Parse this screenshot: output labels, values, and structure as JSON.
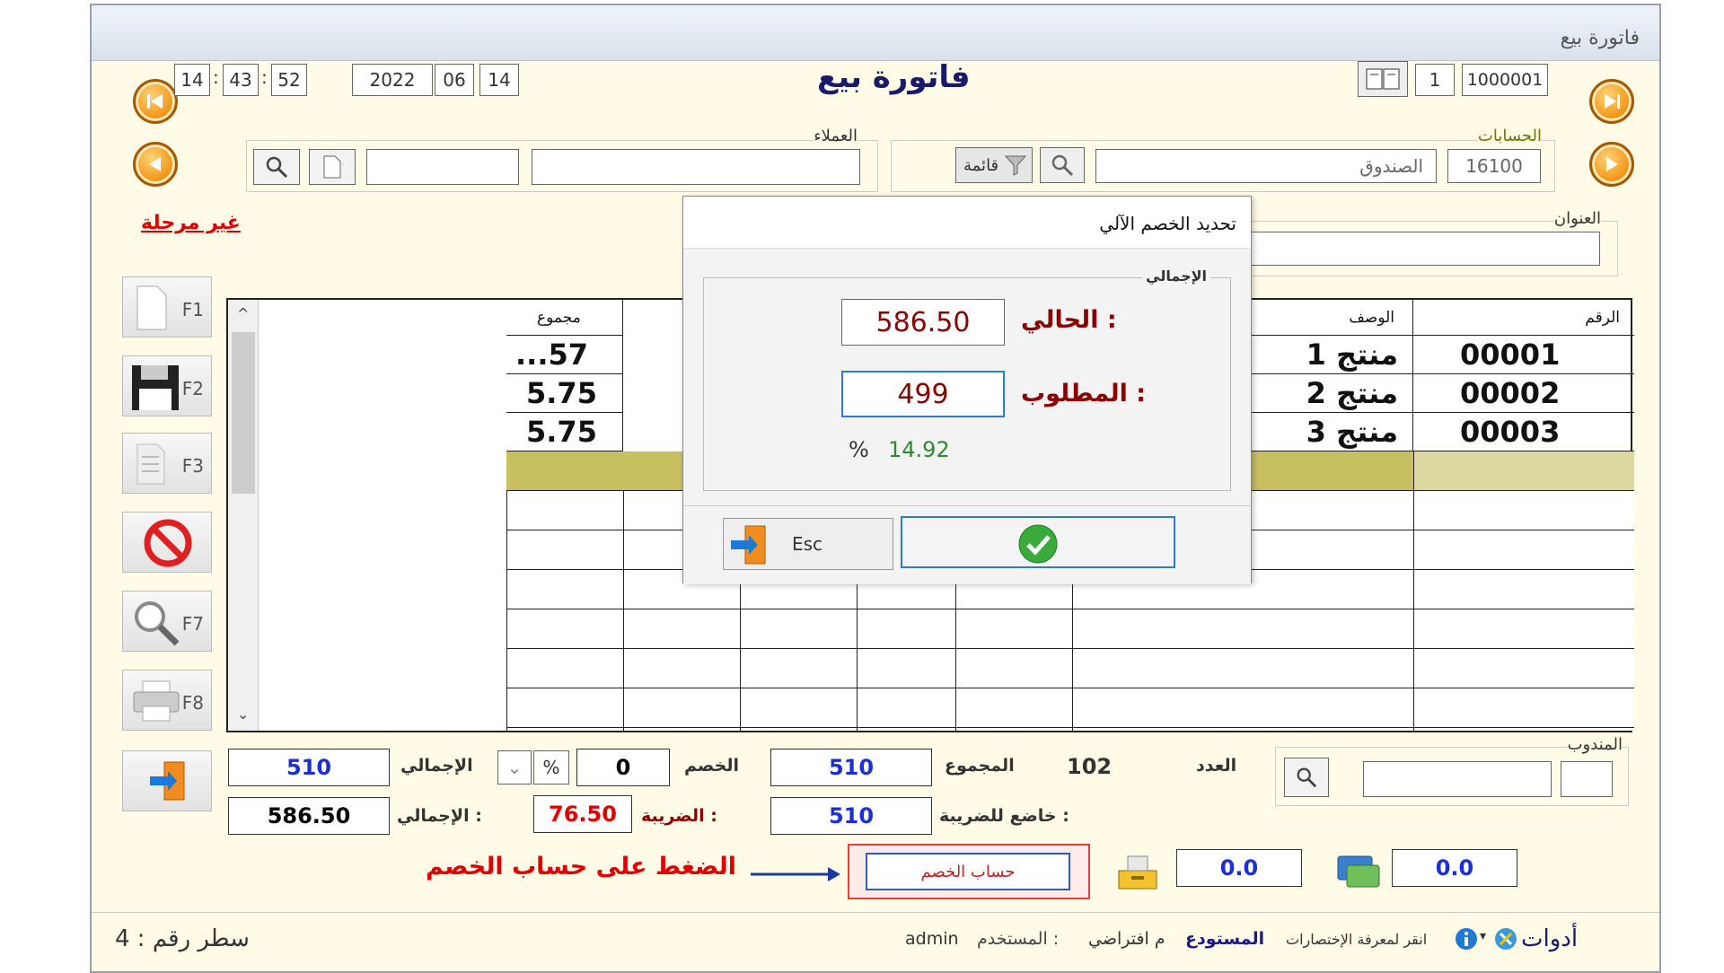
{
  "window": {
    "title": "فاتورة بيع"
  },
  "header": {
    "invoice_title": "فاتورة بيع",
    "time": {
      "hour": "14",
      "minute": "43",
      "second": "52"
    },
    "date": {
      "year": "2022",
      "month": "06",
      "day": "14"
    },
    "invoice_no": "1000001",
    "copy_no": "1"
  },
  "accounts": {
    "label": "الحسابات",
    "code": "16100",
    "name": "الصندوق",
    "list_button": "قائمة"
  },
  "customers": {
    "label": "العملاء",
    "name": "",
    "code": ""
  },
  "address": {
    "label": "العنوان",
    "value": ""
  },
  "status_flag": "غير مرحلة",
  "side_keys": [
    "F1",
    "F2",
    "F3",
    "F7",
    "F8"
  ],
  "grid": {
    "columns": {
      "code": "الرقم",
      "description": "الوصف",
      "total": "مجموع"
    },
    "rows": [
      {
        "code": "00001",
        "description": "منتج 1",
        "total": "...57"
      },
      {
        "code": "00002",
        "description": "منتج 2",
        "total": "5.75"
      },
      {
        "code": "00003",
        "description": "منتج 3",
        "total": "5.75"
      }
    ]
  },
  "dialog": {
    "title": "تحديد الخصم الآلي",
    "group": "الإجمالي",
    "current_label": "الحالي :",
    "current_value": "586.50",
    "required_label": "المطلوب :",
    "required_value": "499",
    "percent_value": "14.92",
    "percent_sign": "%",
    "esc_label": "Esc"
  },
  "totals": {
    "salesman_label": "المندوب",
    "count_label": "العدد",
    "count_value": "102",
    "sum_label": "المجموع",
    "sum_value": "510",
    "discount_label": "الخصم",
    "discount_value": "0",
    "discount_unit": "%",
    "total_label": "الإجمالي",
    "total_value": "510",
    "taxable_label": "خاضع للضريبة :",
    "taxable_value": "510",
    "tax_label": "الضريبة :",
    "tax_value": "76.50",
    "grand_label": "الإجمالي :",
    "grand_value": "586.50",
    "discount_calc_button": "حساب الخصم",
    "left_value": "0.0",
    "right_value": "0.0"
  },
  "annotation": {
    "text": "الضغط على حساب الخصم"
  },
  "statusbar": {
    "tools": "أدوات",
    "shortcuts_hint": "انقر لمعرفة الإختصارات",
    "warehouse_label": "المستودع",
    "warehouse_value": "م افتراضي",
    "user_label": "المستخدم :",
    "user_value": "admin",
    "line_label": "سطر رقم : 4"
  },
  "colors": {
    "accent_red": "#e00000",
    "value_blue": "#1a2fd6",
    "value_green": "#2f8a2f",
    "dialog_red": "#8b0000"
  }
}
